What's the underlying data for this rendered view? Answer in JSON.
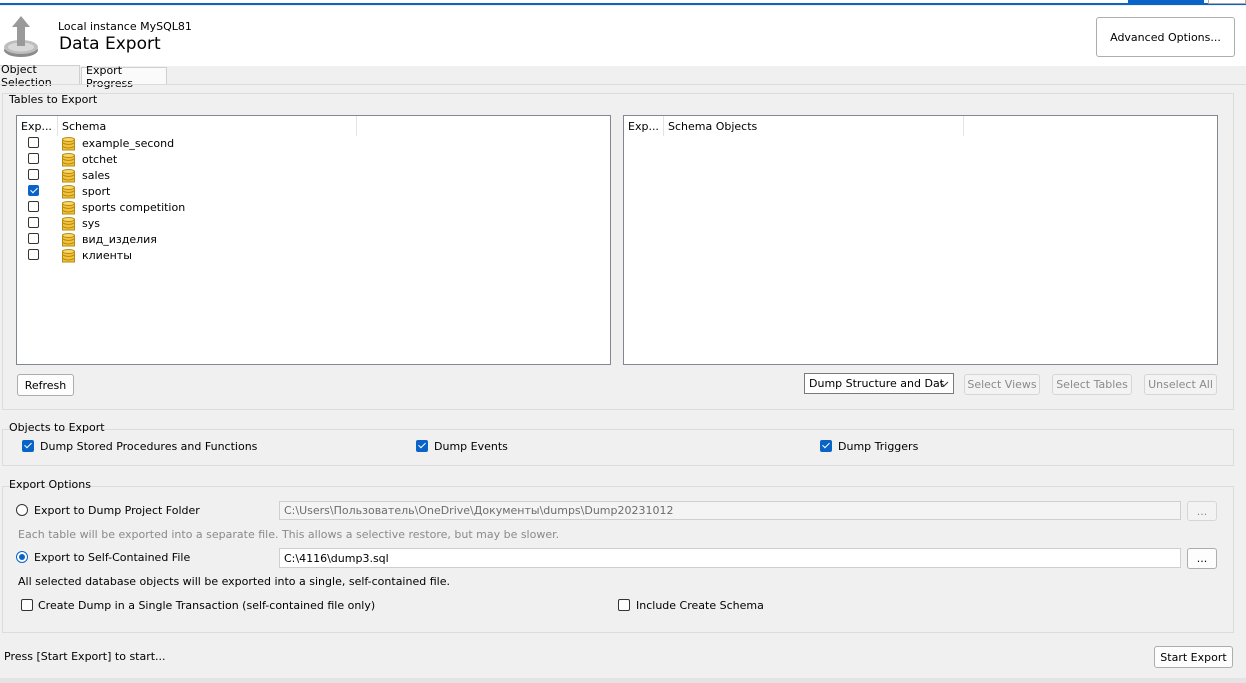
{
  "header": {
    "subtitle": "Local instance MySQL81",
    "title": "Data Export",
    "advanced_button": "Advanced Options..."
  },
  "tabs": [
    {
      "label": "Object Selection"
    },
    {
      "label": "Export Progress"
    }
  ],
  "tables_to_export": {
    "group_label": "Tables to Export",
    "left_columns": [
      "Exp...",
      "Schema"
    ],
    "right_columns": [
      "Exp...",
      "Schema Objects"
    ],
    "schemas": [
      {
        "name": "example_second",
        "checked": false
      },
      {
        "name": "otchet",
        "checked": false
      },
      {
        "name": "sales",
        "checked": false
      },
      {
        "name": "sport",
        "checked": true
      },
      {
        "name": "sports competition",
        "checked": false
      },
      {
        "name": "sys",
        "checked": false
      },
      {
        "name": "вид_изделия",
        "checked": false
      },
      {
        "name": "клиенты",
        "checked": false
      }
    ],
    "refresh_button": "Refresh",
    "dump_mode": "Dump Structure and Dat",
    "select_views": "Select Views",
    "select_tables": "Select Tables",
    "unselect_all": "Unselect All"
  },
  "objects_to_export": {
    "group_label": "Objects to Export",
    "dump_routines": "Dump Stored Procedures and Functions",
    "dump_events": "Dump Events",
    "dump_triggers": "Dump Triggers"
  },
  "export_options": {
    "group_label": "Export Options",
    "folder_option": "Export to Dump Project Folder",
    "folder_path": "C:\\Users\\Пользователь\\OneDrive\\Документы\\dumps\\Dump20231012",
    "folder_hint": "Each table will be exported into a separate file. This allows a selective restore, but may be slower.",
    "file_option": "Export to Self-Contained File",
    "file_path": "C:\\4116\\dump3.sql",
    "file_hint": "All selected database objects will be exported into a single, self-contained file.",
    "browse_label": "...",
    "single_transaction": "Create Dump in a Single Transaction (self-contained file only)",
    "include_schema": "Include Create Schema"
  },
  "footer": {
    "status": "Press [Start Export] to start...",
    "start_button": "Start Export"
  },
  "colors": {
    "accent": "#0a64c8",
    "db_icon": "#e8b830"
  }
}
